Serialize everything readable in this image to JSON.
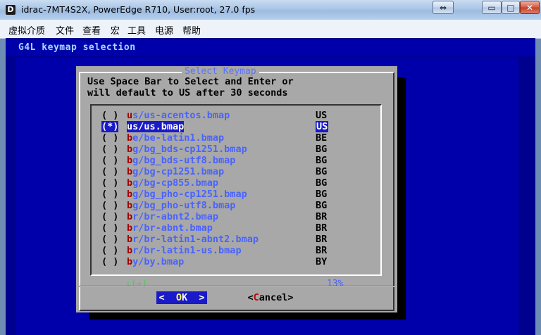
{
  "window": {
    "title": "idrac-7MT4S2X, PowerEdge R710, User:root, 27.0 fps",
    "app_icon_glyph": "D",
    "restore_glyph": "⇔",
    "minimize_glyph": "▭",
    "maximize_glyph": "□",
    "close_glyph": "✕"
  },
  "menu": {
    "items": [
      "虚拟介质",
      "文件",
      "查看",
      "宏",
      "工具",
      "电源",
      "帮助"
    ]
  },
  "console": {
    "title": "G4L keymap selection"
  },
  "dialog": {
    "title": "Select Keymap",
    "prompt_line1": "Use Space Bar to Select and Enter or",
    "prompt_line2": "will default to US after 30 seconds",
    "scroll_indicator": "↓(+)",
    "scroll_percent": "13%",
    "ok_left": "<",
    "ok_hot": "O",
    "ok_rest": "K",
    "ok_right": ">",
    "cancel_left": "<",
    "cancel_hot": "C",
    "cancel_rest": "ancel",
    "cancel_right": ">"
  },
  "keymaps": [
    {
      "radio": "( )",
      "first": "u",
      "rest": "s/us-acentos.bmap",
      "code": "US",
      "selected": false
    },
    {
      "radio": "(*)",
      "first": "u",
      "rest": "s/us.bmap",
      "code": "US",
      "selected": true
    },
    {
      "radio": "( )",
      "first": "b",
      "rest": "e/be-latin1.bmap",
      "code": "BE",
      "selected": false
    },
    {
      "radio": "( )",
      "first": "b",
      "rest": "g/bg_bds-cp1251.bmap",
      "code": "BG",
      "selected": false
    },
    {
      "radio": "( )",
      "first": "b",
      "rest": "g/bg_bds-utf8.bmap",
      "code": "BG",
      "selected": false
    },
    {
      "radio": "( )",
      "first": "b",
      "rest": "g/bg-cp1251.bmap",
      "code": "BG",
      "selected": false
    },
    {
      "radio": "( )",
      "first": "b",
      "rest": "g/bg-cp855.bmap",
      "code": "BG",
      "selected": false
    },
    {
      "radio": "( )",
      "first": "b",
      "rest": "g/bg_pho-cp1251.bmap",
      "code": "BG",
      "selected": false
    },
    {
      "radio": "( )",
      "first": "b",
      "rest": "g/bg_pho-utf8.bmap",
      "code": "BG",
      "selected": false
    },
    {
      "radio": "( )",
      "first": "b",
      "rest": "r/br-abnt2.bmap",
      "code": "BR",
      "selected": false
    },
    {
      "radio": "( )",
      "first": "b",
      "rest": "r/br-abnt.bmap",
      "code": "BR",
      "selected": false
    },
    {
      "radio": "( )",
      "first": "b",
      "rest": "r/br-latin1-abnt2.bmap",
      "code": "BR",
      "selected": false
    },
    {
      "radio": "( )",
      "first": "b",
      "rest": "r/br-latin1-us.bmap",
      "code": "BR",
      "selected": false
    },
    {
      "radio": "( )",
      "first": "b",
      "rest": "y/by.bmap",
      "code": "BY",
      "selected": false
    }
  ]
}
